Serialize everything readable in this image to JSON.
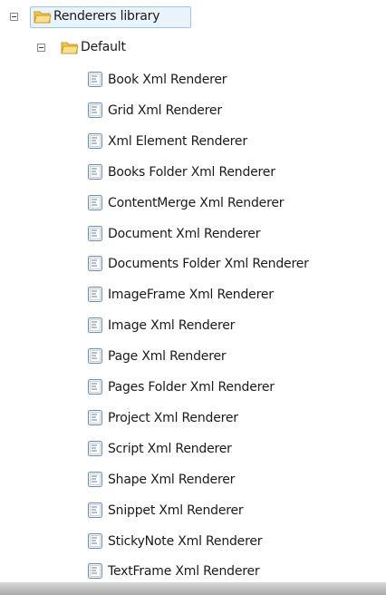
{
  "tree": {
    "root": {
      "label": "Renderers library",
      "expanded": true,
      "children_group": {
        "label": "Default",
        "expanded": true,
        "items": [
          "Book Xml Renderer",
          "Grid Xml Renderer",
          "Xml Element Renderer",
          "Books Folder Xml Renderer",
          "ContentMerge Xml Renderer",
          "Document Xml Renderer",
          "Documents Folder Xml Renderer",
          "ImageFrame Xml Renderer",
          "Image Xml Renderer",
          "Page Xml Renderer",
          "Pages Folder Xml Renderer",
          "Project Xml Renderer",
          "Script Xml Renderer",
          "Shape Xml Renderer",
          "Snippet Xml Renderer",
          "StickyNote Xml Renderer",
          "TextFrame Xml Renderer"
        ]
      }
    }
  },
  "icons": {
    "toggle": "collapse-minus-icon",
    "folder": "folder-icon",
    "item": "document-icon"
  },
  "colors": {
    "selection_border": "#9fc7e7",
    "selection_fill": "#e9f3fb",
    "folder_fill": "#f6d36b",
    "doc_border": "#6e8fb0"
  }
}
